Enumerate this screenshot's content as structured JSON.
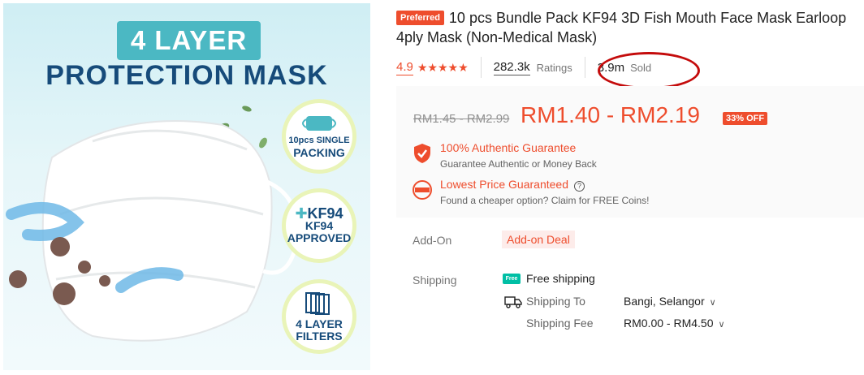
{
  "image": {
    "badge_text": "4 LAYER",
    "headline": "PROTECTION MASK",
    "features": [
      {
        "line1": "10pcs SINGLE",
        "line2": "PACKING"
      },
      {
        "line1": "KF94",
        "line2": "KF94",
        "line3": "APPROVED"
      },
      {
        "line1": "4 LAYER",
        "line2": "FILTERS"
      }
    ]
  },
  "product": {
    "tag": "Preferred",
    "title": "10 pcs Bundle Pack KF94 3D Fish Mouth Face Mask Earloop 4ply Mask (Non-Medical Mask)",
    "rating": "4.9",
    "stars": "★★★★★",
    "ratings_count": "282.3k",
    "ratings_label": "Ratings",
    "sold_count": "3.9m",
    "sold_label": "Sold"
  },
  "price": {
    "original": "RM1.45 - RM2.99",
    "current": "RM1.40 - RM2.19",
    "discount": "33% OFF"
  },
  "guarantees": [
    {
      "title": "100% Authentic Guarantee",
      "subtitle": "Guarantee Authentic or Money Back"
    },
    {
      "title": "Lowest Price Guaranteed",
      "subtitle": "Found a cheaper option? Claim for FREE Coins!"
    }
  ],
  "addon": {
    "label": "Add-On",
    "deal": "Add-on Deal"
  },
  "shipping": {
    "label": "Shipping",
    "free_badge": "Free",
    "free_text": "Free shipping",
    "to_label": "Shipping To",
    "to_value": "Bangi, Selangor",
    "fee_label": "Shipping Fee",
    "fee_value": "RM0.00 - RM4.50"
  },
  "colors": {
    "accent": "#ee4d2d",
    "annotation_circle": "#c40b0b"
  }
}
